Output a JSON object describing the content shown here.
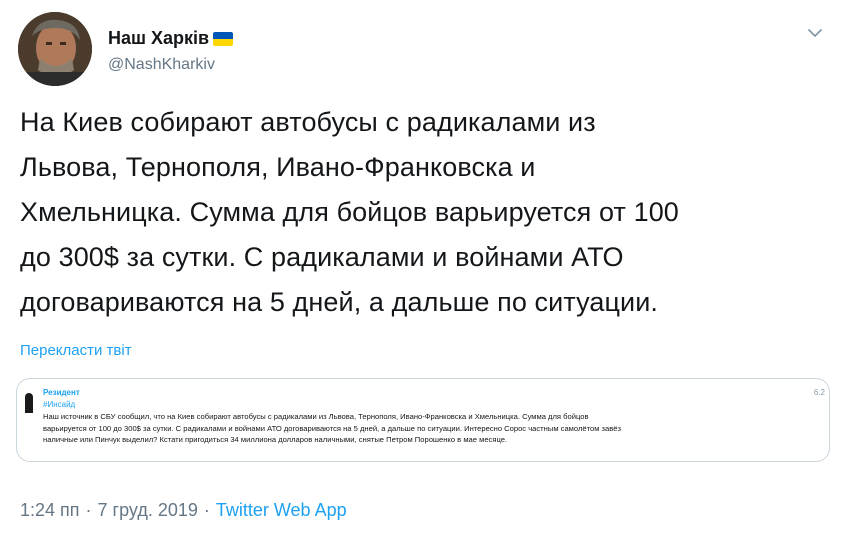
{
  "author": {
    "name": "Наш Харків",
    "handle": "@NashKharkiv"
  },
  "tweet": {
    "text": "На Киев собирают автобусы с радикалами из\nЛьвова, Тернополя, Ивано-Франковска и\nХмельницка. Сумма для бойцов варьируется от 100\nдо 300$ за сутки. С радикалами и войнами АТО\nдоговариваются на 5 дней, а дальше по ситуации.",
    "translate_label": "Перекласти твіт"
  },
  "quoted": {
    "author": "Резидент",
    "hashtag": "#Инсайд",
    "date": "6.2",
    "text": "Наш источник в СБУ сообщил, что на Киев собирают автобусы с радикалами из Львова, Тернополя, Ивано-Франковска и Хмельницка. Сумма для бойцов\nварьируется от 100 до 300$ за сутки. С радикалами и войнами АТО договариваются на 5 дней, а дальше по ситуации. Интересно Сорос частным самолётом завёз\nналичные или Пинчук выделил? Кстати пригодиться 34 миллиона долларов наличными, снятые Петром Порошенко в мае месяце."
  },
  "meta": {
    "time": "1:24 пп",
    "separator1": "·",
    "date": "7 груд. 2019",
    "separator2": "·",
    "source": "Twitter Web App"
  },
  "colors": {
    "link": "#1da1f2",
    "secondary": "#657786",
    "flag_blue": "#0057b7",
    "flag_yellow": "#ffd700"
  },
  "icons": {
    "caret": "chevron-down-icon",
    "flag": "ukraine-flag-icon"
  }
}
